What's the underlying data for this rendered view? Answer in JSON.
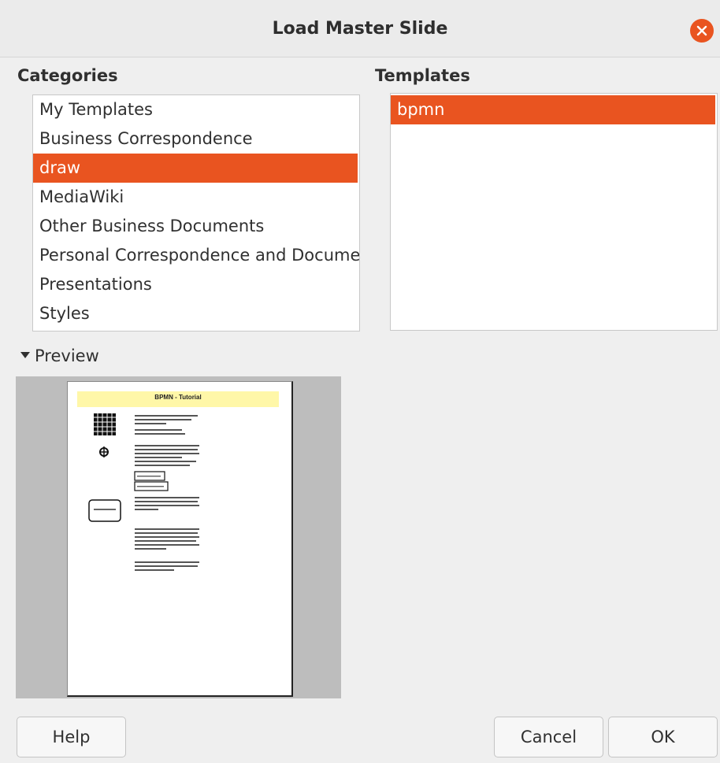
{
  "dialog": {
    "title": "Load Master Slide"
  },
  "categories": {
    "heading": "Categories",
    "items": [
      "My Templates",
      "Business Correspondence",
      "draw",
      "MediaWiki",
      "Other Business Documents",
      "Personal Correspondence and Documents",
      "Presentations",
      "Styles"
    ],
    "selected": "draw"
  },
  "templates": {
    "heading": "Templates",
    "items": [
      "bpmn"
    ],
    "selected": "bpmn"
  },
  "preview": {
    "label": "Preview",
    "expanded": true,
    "page_title": "BPMN - Tutorial"
  },
  "buttons": {
    "help": "Help",
    "cancel": "Cancel",
    "ok": "OK"
  },
  "colors": {
    "accent": "#e95420",
    "background": "#efefef"
  }
}
